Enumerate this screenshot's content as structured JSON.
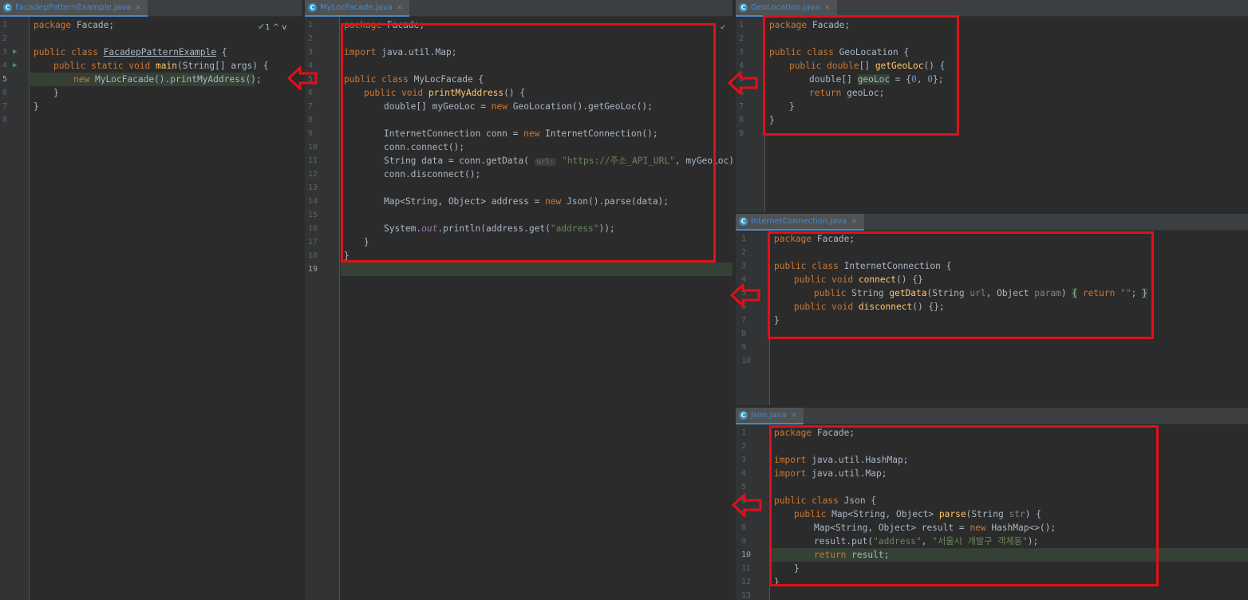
{
  "tabs": {
    "facade_example": "FacadepPatternExample.java",
    "my_loc_facade": "MyLocFacade.java",
    "geo_location": "GeoLocation.java",
    "internet_connection": "InternetConnection.java",
    "json": "Json.java"
  },
  "icons": {
    "class_icon": "C",
    "close_icon": "×",
    "check_icon": "✔",
    "run_icon": "▶",
    "chevron_up_icon": "^",
    "chevron_down_icon": "v",
    "warning_count_label": "1"
  },
  "colors": {
    "highlight_box": "#e0101a",
    "tab_active": "#4a88c7"
  },
  "line_numbers": {
    "facade_example": [
      "1",
      "2",
      "3",
      "4",
      "5",
      "6",
      "7",
      "8"
    ],
    "my_loc_facade": [
      "1",
      "2",
      "3",
      "4",
      "5",
      "6",
      "7",
      "8",
      "9",
      "10",
      "11",
      "12",
      "13",
      "14",
      "15",
      "16",
      "17",
      "18",
      "19"
    ],
    "geo_location": [
      "1",
      "2",
      "3",
      "4",
      "5",
      "6",
      "7",
      "8",
      "9"
    ],
    "internet_connection": [
      "1",
      "2",
      "3",
      "4",
      "5",
      "6",
      "7",
      "8",
      "9",
      "10"
    ],
    "json": [
      "1",
      "2",
      "3",
      "4",
      "5",
      "6",
      "7",
      "8",
      "9",
      "10",
      "11",
      "12",
      "13"
    ]
  },
  "tokens": {
    "package": "package",
    "facade": "Facade;",
    "public": "public",
    "class": "class",
    "static": "static",
    "void": "void",
    "import": "import",
    "new": "new",
    "return": "return",
    "double": "double",
    "brace_open": "{",
    "brace_close": "}",
    "str_type": "String",
    "object_type": "Object>",
    "map_open": "Map<String,",
    "main": "main",
    "main_args": "(String[] args) {",
    "facade_example_name": "FacadepPatternExample",
    "facade_example_brace": " {",
    "call_new_facade": "MyLocFacade().printMyAddress();",
    "import_map": "java.util.Map;",
    "import_hashmap": "java.util.HashMap;",
    "my_loc_facade_name": "MyLocFacade {",
    "print_my_address": "printMyAddress",
    "print_sig": "() {",
    "double_arr": "double[]",
    "my_geo_loc_decl": "myGeoLoc =",
    "geo_location_call": "GeoLocation().getGeoLoc();",
    "inet_decl": "InternetConnection conn =",
    "inet_new": "InternetConnection();",
    "conn_connect": "conn.connect();",
    "string_data": "String data = conn.getData(",
    "url_hint": "url:",
    "api_url": "\"https://주소_API_URL\"",
    "my_geo_loc_arg": ", myGeoLoc);",
    "conn_disconnect": "conn.disconnect();",
    "address_decl": "Map<String, Object> address =",
    "json_parse": "Json().parse(data);",
    "system_prefix": "System.",
    "out": "out",
    "println_prefix": ".println(address.get(",
    "address_str": "\"address\"",
    "close_paren_semi": "));",
    "geo_location_name": "GeoLocation {",
    "get_geo_loc": "getGeoLoc",
    "geo_loc_var": "geoLoc",
    "assign_open": " = {",
    "zero": "0",
    "comma": ", ",
    "close_brace_semi": "};",
    "geo_loc_return": "geoLoc;",
    "internet_connection_name": "InternetConnection {",
    "connect": "connect",
    "empty_body": "() {}",
    "get_data": "getData",
    "get_data_open": "(String ",
    "url_param": "url",
    "object_param_prefix": ", Object ",
    "param_word": "param",
    "paren_close": ")",
    "return_empty": "\"\"",
    "semi": ";",
    "disconnect": "disconnect",
    "empty_body_semi": "() {};",
    "json_name": "Json {",
    "parse": "parse",
    "parse_open": "(String ",
    "str_param": "str",
    "paren_brace": ") {",
    "result_decl": "Map<String, Object> result =",
    "hashmap_new": "HashMap<>();",
    "result_put": "result.put(",
    "korean_address": "\"서울시 개발구 객체동\"",
    "paren_semi": ");",
    "result_return": " result;"
  }
}
